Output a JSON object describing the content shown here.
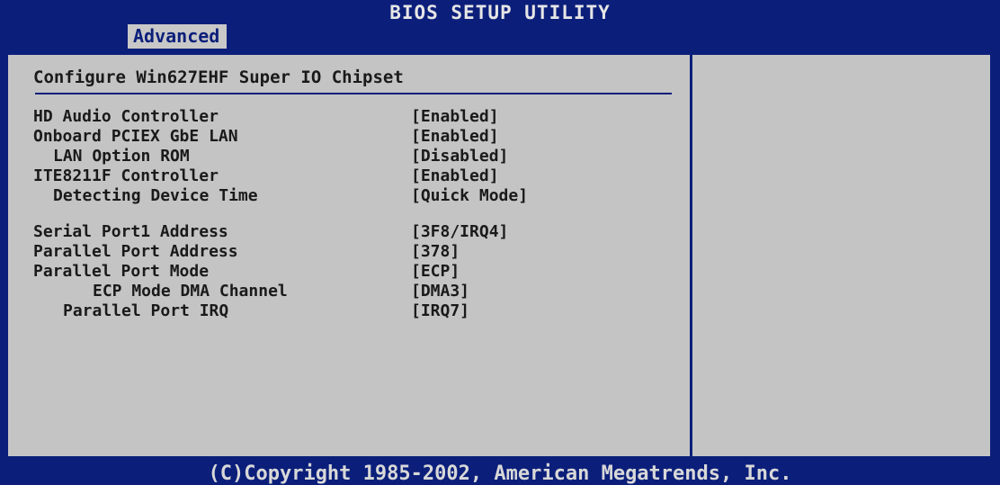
{
  "header": {
    "title": "BIOS SETUP UTILITY",
    "active_tab": "Advanced"
  },
  "panel": {
    "heading": "Configure Win627EHF Super IO Chipset",
    "items_group1": [
      {
        "label": "HD Audio Controller",
        "value": "[Enabled]",
        "indent": 0
      },
      {
        "label": "Onboard PCIEX GbE LAN",
        "value": "[Enabled]",
        "indent": 0
      },
      {
        "label": "LAN Option ROM",
        "value": "[Disabled]",
        "indent": 2
      },
      {
        "label": "ITE8211F Controller",
        "value": "[Enabled]",
        "indent": 0
      },
      {
        "label": "Detecting Device Time",
        "value": "[Quick Mode]",
        "indent": 2
      }
    ],
    "items_group2": [
      {
        "label": "Serial Port1 Address",
        "value": "[3F8/IRQ4]",
        "indent": 0
      },
      {
        "label": "Parallel Port Address",
        "value": "[378]",
        "indent": 0
      },
      {
        "label": "Parallel Port Mode",
        "value": "[ECP]",
        "indent": 0
      },
      {
        "label": "ECP Mode DMA Channel",
        "value": "[DMA3]",
        "indent": 6
      },
      {
        "label": "Parallel Port IRQ",
        "value": "[IRQ7]",
        "indent": 3
      }
    ]
  },
  "footer": {
    "copyright": "(C)Copyright 1985-2002, American Megatrends, Inc."
  }
}
